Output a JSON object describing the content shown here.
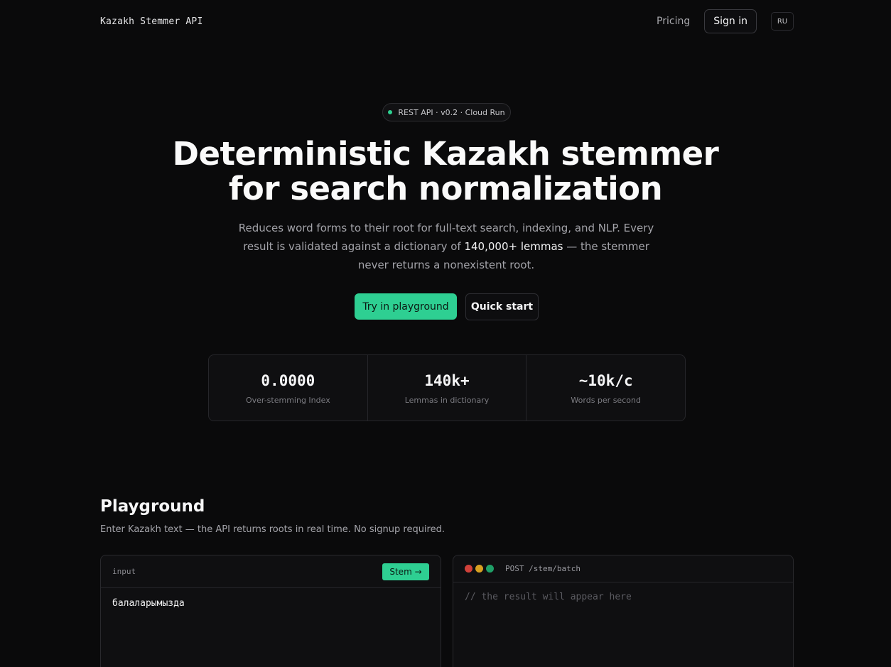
{
  "header": {
    "brand": "Kazakh Stemmer API",
    "pricing": "Pricing",
    "sign_in": "Sign in",
    "lang": "RU"
  },
  "hero": {
    "badge": "REST API · v0.2 · Cloud Run",
    "title_line1": "Deterministic Kazakh stemmer",
    "title_line2": "for search normalization",
    "subtitle_before": "Reduces word forms to their root for full-text search, indexing, and NLP. Every result is validated against a dictionary of ",
    "subtitle_highlight": "140,000+ lemmas",
    "subtitle_after": " — the stemmer never returns a nonexistent root.",
    "primary_cta": "Try in playground",
    "secondary_cta": "Quick start"
  },
  "stats": [
    {
      "value": "0.0000",
      "label": "Over-stemming Index"
    },
    {
      "value": "140k+",
      "label": "Lemmas in dictionary"
    },
    {
      "value": "~10k/c",
      "label": "Words per second"
    }
  ],
  "playground": {
    "title": "Playground",
    "subtitle": "Enter Kazakh text — the API returns roots in real time. No signup required.",
    "input_label": "input",
    "stem_button": "Stem →",
    "input_value": "балаларымызда",
    "endpoint": "POST /stem/batch",
    "result_placeholder": "// the result will appear here"
  },
  "colors": {
    "accent": "#2ecf92",
    "background": "#0a0a0b",
    "dot_red": "#d0413a",
    "dot_yellow": "#d7a021",
    "dot_green": "#1f9f67"
  }
}
